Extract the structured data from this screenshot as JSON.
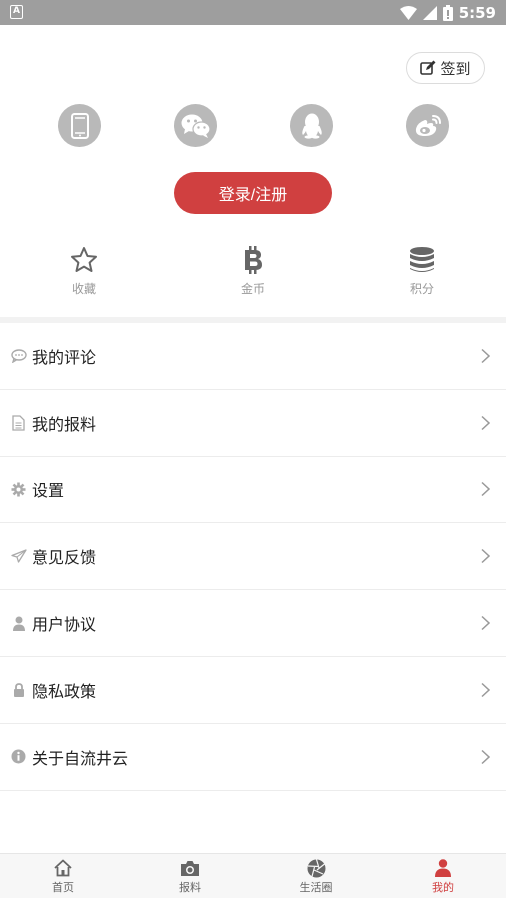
{
  "status_bar": {
    "time": "5:59"
  },
  "header": {
    "signin_label": "签到"
  },
  "login": {
    "button_label": "登录/注册"
  },
  "stats": [
    {
      "label": "收藏",
      "icon": "star-icon"
    },
    {
      "label": "金币",
      "icon": "bitcoin-icon"
    },
    {
      "label": "积分",
      "icon": "database-icon"
    }
  ],
  "menu": [
    {
      "label": "我的评论",
      "icon": "comment-icon"
    },
    {
      "label": "我的报料",
      "icon": "document-icon"
    },
    {
      "label": "设置",
      "icon": "gear-icon"
    },
    {
      "label": "意见反馈",
      "icon": "paper-plane-icon"
    },
    {
      "label": "用户协议",
      "icon": "user-icon"
    },
    {
      "label": "隐私政策",
      "icon": "lock-icon"
    },
    {
      "label": "关于自流井云",
      "icon": "info-icon"
    }
  ],
  "tabbar": [
    {
      "label": "首页",
      "icon": "home-icon"
    },
    {
      "label": "报料",
      "icon": "camera-icon"
    },
    {
      "label": "生活圈",
      "icon": "aperture-icon"
    },
    {
      "label": "我的",
      "icon": "person-icon"
    }
  ],
  "colors": {
    "accent": "#d04040",
    "icon_gray": "#b9b9b9",
    "status_bar": "#9e9e9e"
  }
}
